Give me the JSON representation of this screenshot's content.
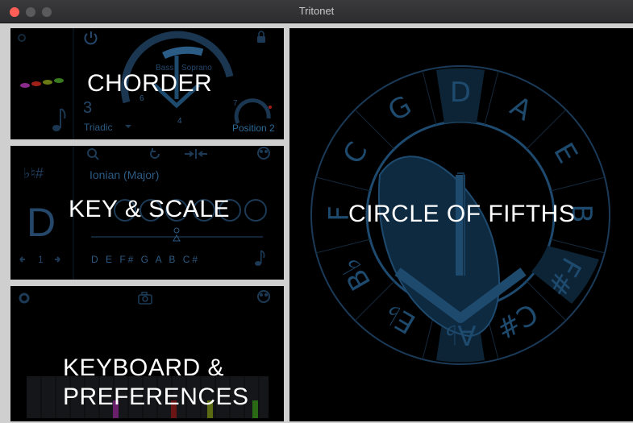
{
  "window": {
    "title": "Tritonet"
  },
  "chorder": {
    "label": "CHORDER",
    "bass_label": "Bass",
    "soprano_label": "Soprano",
    "num_6": "6",
    "num_4": "4",
    "num_7": "7",
    "big_num": "3",
    "mode": "Triadic",
    "position": "Position 2",
    "dot_colors": [
      "#8a2a8a",
      "#a0201a",
      "#6a7a14",
      "#3a7a20"
    ]
  },
  "key_scale": {
    "label": "KEY & SCALE",
    "accidentals": "♭♮#",
    "scale_name": "Ionian (Major)",
    "key_letter": "D",
    "octave": "1",
    "notes": "D E F# G A B C#"
  },
  "keyboard": {
    "label_line1": "KEYBOARD &",
    "label_line2": "PREFERENCES"
  },
  "circle": {
    "label": "CIRCLE OF FIFTHS",
    "keys": [
      "D",
      "A",
      "E",
      "B",
      "F#",
      "C#",
      "A♭",
      "E♭",
      "B♭",
      "F",
      "C",
      "G"
    ]
  },
  "colors": {
    "accent_blue": "#1d4a6e",
    "dim_blue": "#24476a",
    "highlight_blue": "#1e5a80"
  },
  "icons": [
    "power-icon",
    "lock-icon",
    "note-icon",
    "search-icon",
    "refresh-icon",
    "collapse-icon",
    "smiley-icon",
    "gear-icon",
    "camera-icon"
  ]
}
